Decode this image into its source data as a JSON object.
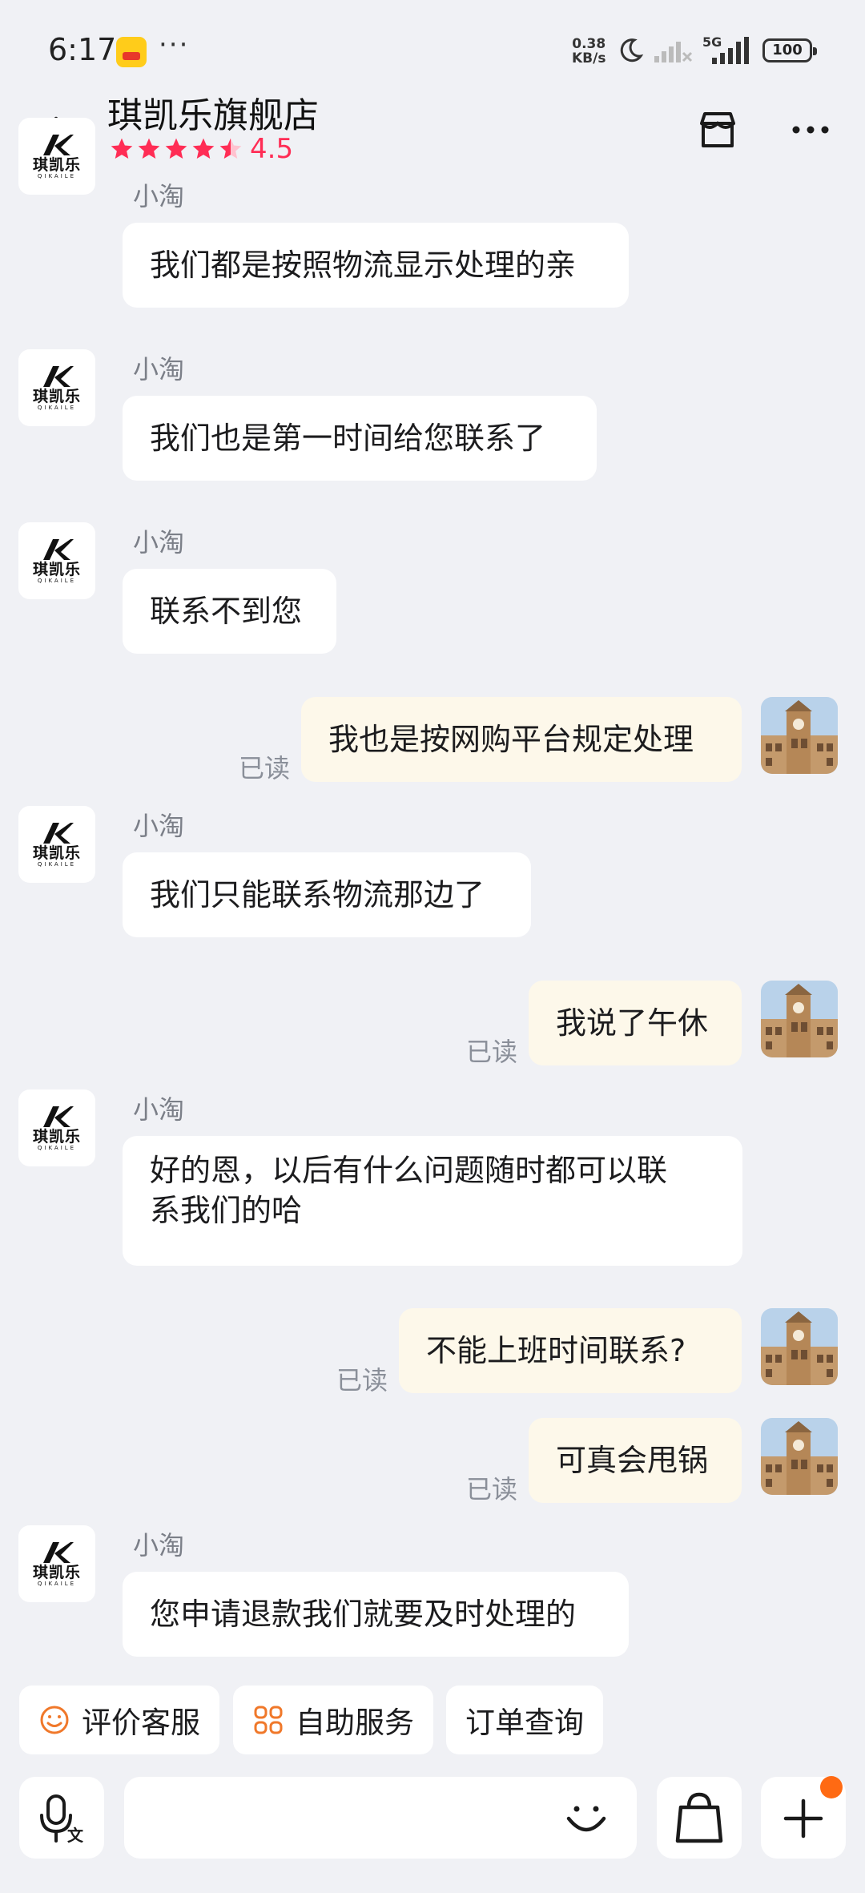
{
  "status_bar": {
    "time": "6:17",
    "more": "···",
    "speed_value": "0.38",
    "speed_unit": "KB/s",
    "network": "5G",
    "battery": "100"
  },
  "header": {
    "title": "琪凯乐旗舰店",
    "rating": "4.5",
    "icons": [
      "back-arrow-icon",
      "store-icon",
      "more-icon"
    ]
  },
  "shop_logo": {
    "name": "琪凯乐",
    "sub": "QIKAILE"
  },
  "messages": [
    {
      "side": "left",
      "sender": "小淘",
      "text": "我们都是按照物流显示处理的亲"
    },
    {
      "side": "left",
      "sender": "小淘",
      "text": "我们也是第一时间给您联系了"
    },
    {
      "side": "left",
      "sender": "小淘",
      "text": "联系不到您"
    },
    {
      "side": "right",
      "status": "已读",
      "text": "我也是按网购平台规定处理"
    },
    {
      "side": "left",
      "sender": "小淘",
      "text": "我们只能联系物流那边了"
    },
    {
      "side": "right",
      "status": "已读",
      "text": "我说了午休"
    },
    {
      "side": "left",
      "sender": "小淘",
      "text_line1": "好的恩，以后有什么问题随时都可以联",
      "text_line2": "系我们的哈"
    },
    {
      "side": "right",
      "status": "已读",
      "text": "不能上班时间联系?"
    },
    {
      "side": "right",
      "status": "已读",
      "text": "可真会甩锅"
    },
    {
      "side": "left",
      "sender": "小淘",
      "text": "您申请退款我们就要及时处理的"
    }
  ],
  "quick_actions": [
    {
      "label": "评价客服",
      "icon": "smile-icon"
    },
    {
      "label": "自助服务",
      "icon": "grid-icon"
    },
    {
      "label": "订单查询",
      "icon": ""
    }
  ],
  "input_bar": {
    "icons": [
      "voice-translate-icon",
      "emoji-icon",
      "shopping-bag-icon",
      "plus-icon"
    ],
    "voice_glyph": "文"
  },
  "colors": {
    "background": "#f0f1f5",
    "bubble_other": "#ffffff",
    "bubble_mine": "#fdf8ea",
    "rating": "#ff2d55",
    "chip_icon": "#f0782a",
    "notification_dot": "#ff6a13"
  }
}
